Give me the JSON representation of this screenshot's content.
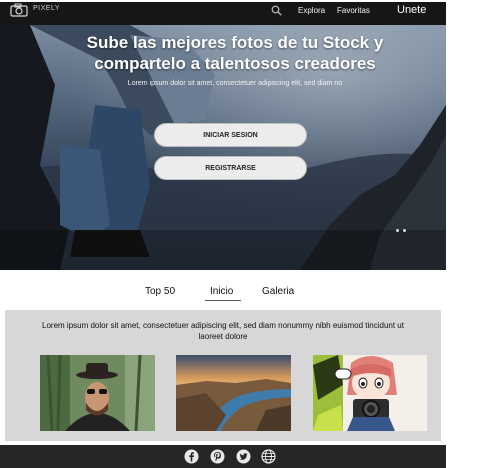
{
  "header": {
    "brand": "PIXELY",
    "nav": {
      "explora": "Explora",
      "favoritas": "Favoritas",
      "unete": "Unete"
    }
  },
  "hero": {
    "headline": "Sube las mejores fotos de tu Stock y compartelo a talentosos creadores",
    "subtext": "Lorem ipsum dolor sit amet, consectetuer adipiscing elit, sed diam no",
    "login_label": "INICIAR SESION",
    "register_label": "REGISTRARSE"
  },
  "tabs": [
    {
      "label": "Top 50",
      "active": false
    },
    {
      "label": "Inicio",
      "active": true
    },
    {
      "label": "Galeria",
      "active": false
    }
  ],
  "gallery": {
    "description": "Lorem ipsum dolor sit amet, consectetuer adipiscing elit, sed diam nonummy nibh euismod tincidunt ut laoreet dolore",
    "photos": [
      "man-with-hat-photo",
      "river-canyon-photo",
      "anime-girl-camera-photo"
    ]
  },
  "footer": {
    "icons": [
      "facebook-icon",
      "pinterest-icon",
      "twitter-icon",
      "globe-icon"
    ]
  }
}
